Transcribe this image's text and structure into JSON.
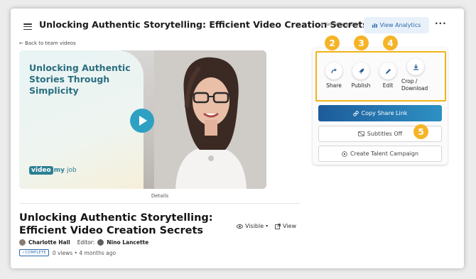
{
  "header": {
    "title": "Unlocking Authentic Storytelling: Efficient Video Creation Secrets",
    "workspace": "Something Else",
    "view_analytics": "View Analytics",
    "more": "···"
  },
  "nav": {
    "back": "← Back to team videos"
  },
  "video": {
    "overlay_title": "Unlocking Authentic Stories Through Simplicity",
    "brand_video": "video",
    "brand_my": "my",
    "brand_job": "job"
  },
  "details_label": "Details",
  "info": {
    "title": "Unlocking Authentic Storytelling: Efficient Video Creation Secrets",
    "visible": "Visible",
    "view": "View",
    "author": "Charlotte Hall",
    "editor_label": "Editor:",
    "editor": "Nino Lancette",
    "status": "COMPLETE",
    "stats": "0 views • 4 months ago"
  },
  "actions": [
    {
      "label": "Share",
      "step": "2",
      "icon": "share-arrow-icon"
    },
    {
      "label": "Publish",
      "step": "3",
      "icon": "rocket-icon"
    },
    {
      "label": "Edit",
      "step": "4",
      "icon": "pencil-icon"
    },
    {
      "label": "Crop / Download",
      "icon": "download-icon"
    }
  ],
  "buttons": {
    "copy_share_link": "Copy Share Link",
    "subtitles": "Subtitles Off",
    "subtitles_step": "5",
    "talent_campaign": "Create Talent Campaign"
  },
  "colors": {
    "accent": "#2b68a8",
    "highlight": "#f2b41b",
    "step_badge": "#f5b428",
    "copy_gradient_start": "#1d5b9b",
    "copy_gradient_end": "#2d91c3",
    "overlay_text": "#2a6f80"
  }
}
